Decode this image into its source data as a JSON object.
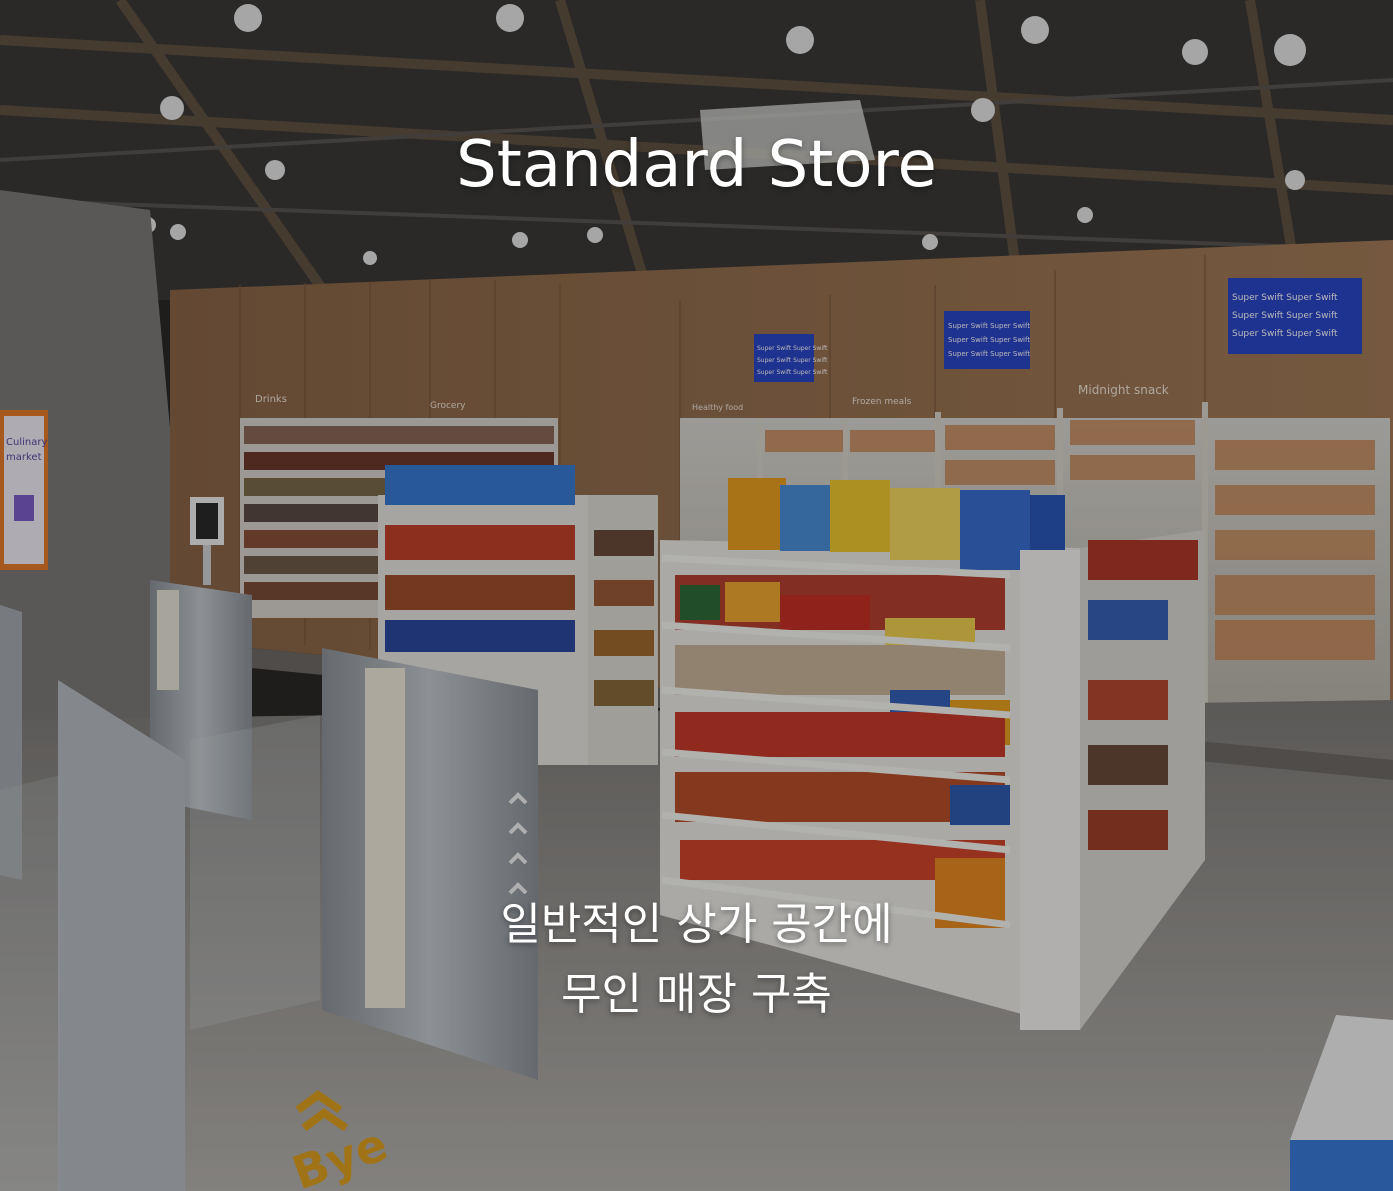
{
  "hero": {
    "title": "Standard Store",
    "subtitle_line1": "일반적인 상가 공간에",
    "subtitle_line2": "무인 매장 구축"
  },
  "store_signs": {
    "drinks": "Drinks",
    "grocery": "Grocery",
    "healthy_food": "Healthy food",
    "frozen_meals": "Frozen meals",
    "midnight_snack": "Midnight snack",
    "screen_brand": "Super Swift",
    "poster_text": "Culinary market",
    "floor_text": "Bye"
  },
  "colors": {
    "wall_wood": "#9a7350",
    "ceiling": "#3a3836",
    "floor": "#8e8b88",
    "shelf_white": "#e9e6e1",
    "screen_blue": "#1f3fbf",
    "gate_silver": "#a8adb3",
    "floor_arrow": "#e0a020"
  }
}
